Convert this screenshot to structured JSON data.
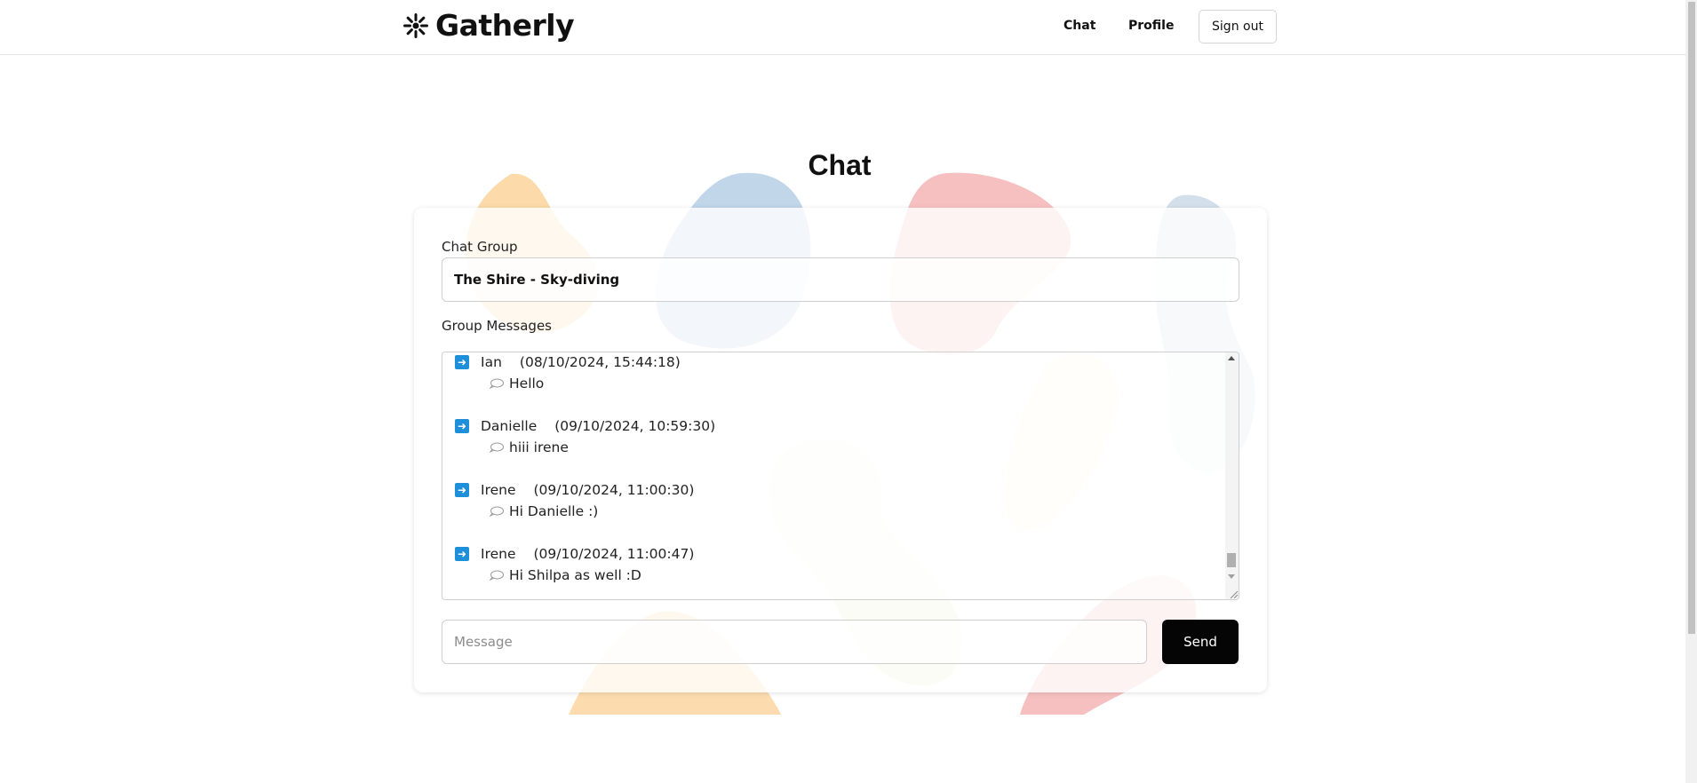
{
  "app": {
    "name": "Gatherly"
  },
  "nav": {
    "chat": "Chat",
    "profile": "Profile",
    "sign_out": "Sign out"
  },
  "page": {
    "title": "Chat"
  },
  "form": {
    "group_label": "Chat Group",
    "group_selected": "The Shire - Sky-diving",
    "messages_label": "Group Messages",
    "message_placeholder": "Message",
    "send_label": "Send"
  },
  "messages": [
    {
      "author": "Ian",
      "time": "(08/10/2024, 15:44:18)",
      "text": "Hello"
    },
    {
      "author": "Danielle",
      "time": "(09/10/2024, 10:59:30)",
      "text": "hiii irene"
    },
    {
      "author": "Irene",
      "time": "(09/10/2024, 11:00:30)",
      "text": "Hi Danielle :)"
    },
    {
      "author": "Irene",
      "time": "(09/10/2024, 11:00:47)",
      "text": "Hi Shilpa as well :D"
    }
  ],
  "colors": {
    "accent": "#1e90d9",
    "button": "#050505"
  },
  "icons": {
    "logo": "sparkle-logo-icon",
    "message_author": "arrow-right-icon",
    "message_text": "speech-bubble-icon"
  }
}
